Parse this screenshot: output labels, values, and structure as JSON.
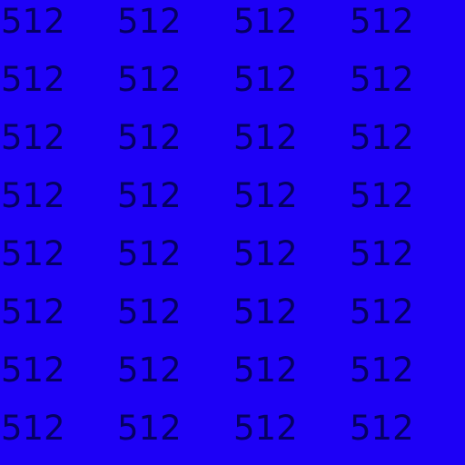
{
  "canvas": {
    "background_color": "#1D00F6",
    "text_color": "#050063"
  },
  "grid": {
    "columns": 4,
    "rows": 8,
    "cell_text": "512"
  }
}
